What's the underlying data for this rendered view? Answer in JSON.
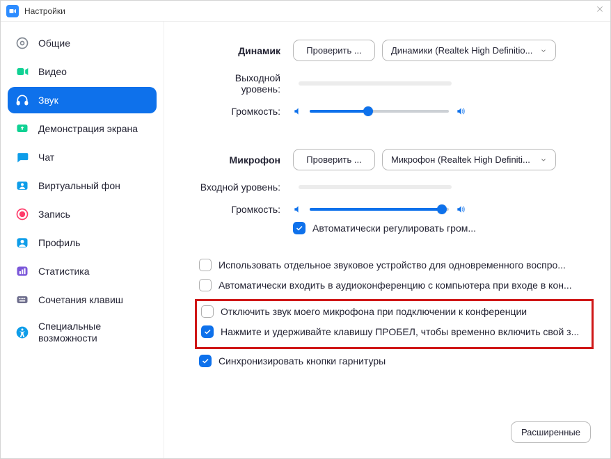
{
  "window": {
    "title": "Настройки"
  },
  "sidebar": {
    "items": [
      {
        "label": "Общие"
      },
      {
        "label": "Видео"
      },
      {
        "label": "Звук"
      },
      {
        "label": "Демонстрация экрана"
      },
      {
        "label": "Чат"
      },
      {
        "label": "Виртуальный фон"
      },
      {
        "label": "Запись"
      },
      {
        "label": "Профиль"
      },
      {
        "label": "Статистика"
      },
      {
        "label": "Сочетания клавиш"
      },
      {
        "label": "Специальные возможности"
      }
    ],
    "active_index": 2
  },
  "audio": {
    "speaker": {
      "section_label": "Динамик",
      "test_button": "Проверить ...",
      "device": "Динамики (Realtek High Definitio...",
      "output_level_label": "Выходной уровень:",
      "volume_label": "Громкость:",
      "volume_percent": 42
    },
    "microphone": {
      "section_label": "Микрофон",
      "test_button": "Проверить ...",
      "device": "Микрофон (Realtek High Definiti...",
      "input_level_label": "Входной уровень:",
      "volume_label": "Громкость:",
      "volume_percent": 95,
      "auto_adjust": {
        "checked": true,
        "label": "Автоматически регулировать гром..."
      }
    },
    "options": {
      "separate_device": {
        "checked": false,
        "label": "Использовать отдельное звуковое устройство для одновременного воспро..."
      },
      "auto_join_audio": {
        "checked": false,
        "label": "Автоматически входить в аудиоконференцию с компьютера при входе в кон..."
      },
      "mute_on_join": {
        "checked": false,
        "label": "Отключить звук моего микрофона при подключении к конференции"
      },
      "space_unmute": {
        "checked": true,
        "label": "Нажмите и удерживайте клавишу ПРОБЕЛ, чтобы временно включить свой з..."
      },
      "sync_headset": {
        "checked": true,
        "label": "Синхронизировать кнопки гарнитуры"
      }
    },
    "advanced_button": "Расширенные"
  }
}
